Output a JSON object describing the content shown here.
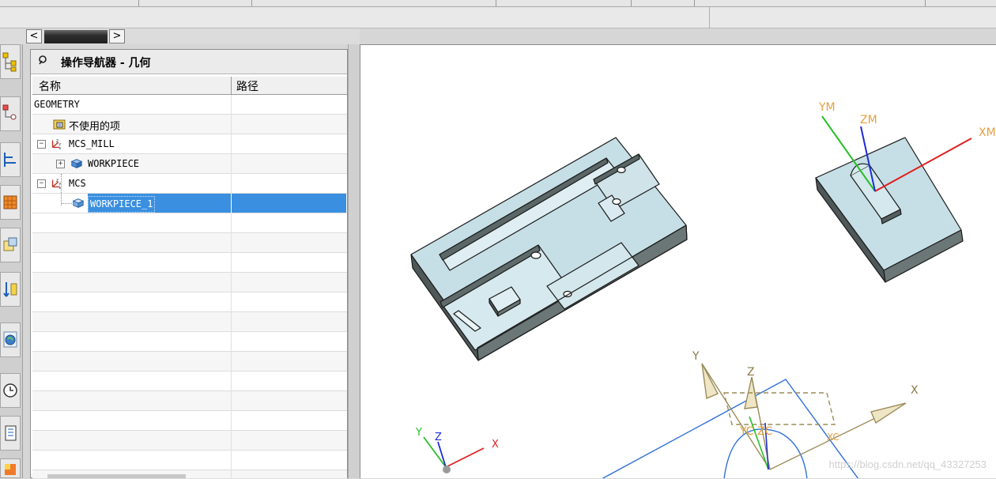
{
  "navigator": {
    "title": "操作导航器 - 几何",
    "columns": {
      "name": "名称",
      "path": "路径"
    },
    "rows": [
      {
        "label": "GEOMETRY",
        "indent": 0
      },
      {
        "label": "不使用的项",
        "indent": 1,
        "icon": "folder-icon"
      },
      {
        "label": "MCS_MILL",
        "indent": 0,
        "icon": "mcs-icon",
        "expander": "minus"
      },
      {
        "label": "WORKPIECE",
        "indent": 1,
        "icon": "workpiece-icon",
        "expander": "plus"
      },
      {
        "label": "MCS",
        "indent": 0,
        "icon": "mcs-icon",
        "expander": "minus"
      },
      {
        "label": "WORKPIECE_1",
        "indent": 1,
        "icon": "workpiece-icon",
        "selected": true
      }
    ]
  },
  "viewport": {
    "axes_large": {
      "x": "X",
      "y": "Y",
      "z": "Z"
    },
    "csys_labels": {
      "xm": "XM",
      "ym": "YM",
      "zm": "ZM"
    },
    "triad": {
      "x": "X",
      "y": "Y",
      "z": "Z"
    },
    "partial_labels": {
      "yc_zc": "YC ZC",
      "xc": "XC"
    },
    "watermark": "https://blog.csdn.net/qq_43327253"
  },
  "resource_bar": {
    "icons": [
      "assembly-navigator-icon",
      "constraint-navigator-icon",
      "part-navigator-icon",
      "reuse-library-icon",
      "hd3d-tools-icon",
      "web-browser-icon",
      "history-icon",
      "process-navigator-icon",
      "palette-icon"
    ]
  }
}
